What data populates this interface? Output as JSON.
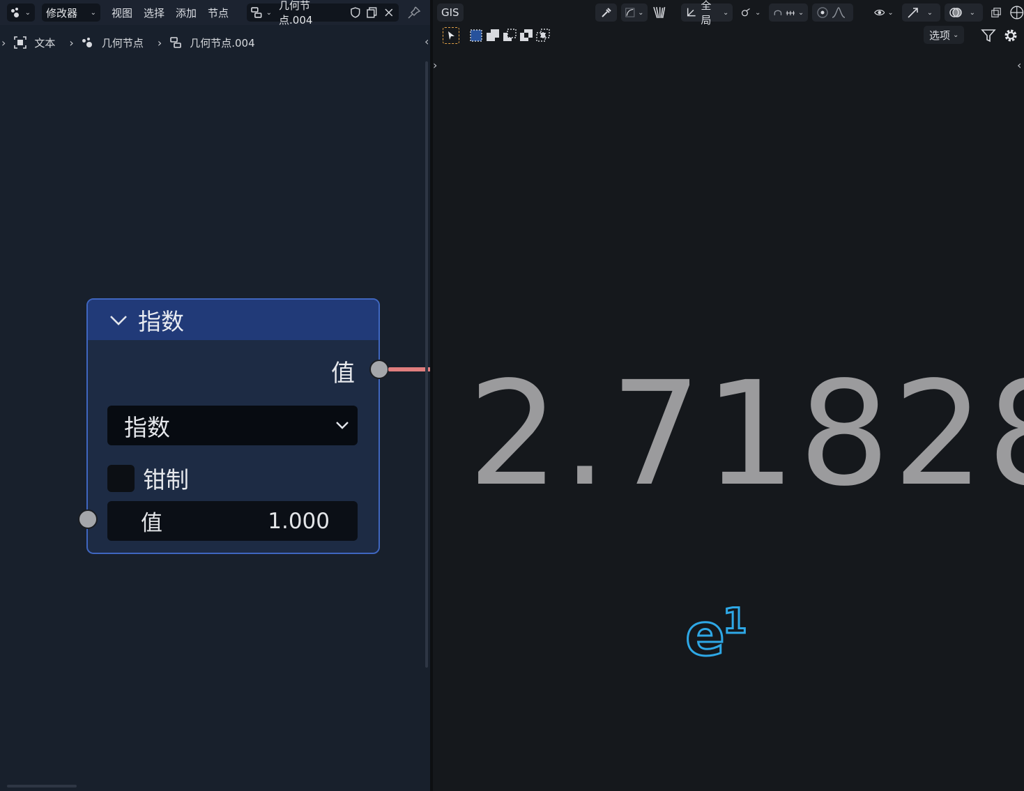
{
  "left_header": {
    "editor_type_icon": "node-editor-icon",
    "modifier_select": "修改器",
    "menus": [
      "视图",
      "选择",
      "添加",
      "节点"
    ],
    "node_group_name": "几何节点.004"
  },
  "breadcrumb": [
    {
      "icon": "object-icon",
      "label": "文本"
    },
    {
      "icon": "geometry-nodes-icon",
      "label": "几何节点"
    },
    {
      "icon": "node-tree-icon",
      "label": "几何节点.004"
    }
  ],
  "node": {
    "title": "指数",
    "output_label": "值",
    "operation": "指数",
    "clamp_label": "钳制",
    "clamp_checked": false,
    "input_label": "值",
    "input_value": "1.000",
    "header_color": "#213a78",
    "border_color": "#3f66c0",
    "link_color": "#e07e7e"
  },
  "right_header": {
    "gis_label": "GIS",
    "transform_orientation": "全局",
    "options_label": "选项"
  },
  "viewport": {
    "result_text": "2.71828",
    "exp_base": "e",
    "exp_power": "1",
    "result_color": "#9b9b9d",
    "exp_color": "#2ea8e6"
  }
}
